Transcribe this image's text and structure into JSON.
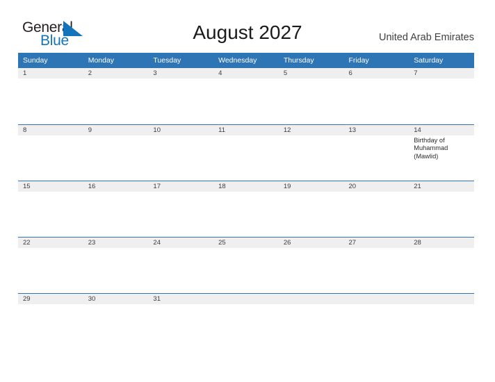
{
  "brand": {
    "name_part1": "General",
    "name_part2": "Blue",
    "triangle_color": "#1275bc",
    "text_color": "#231f20"
  },
  "header": {
    "title": "August 2027",
    "country": "United Arab Emirates"
  },
  "theme": {
    "header_blue": "#2e75b6",
    "day_band_gray": "#efefef",
    "page_background": "#ffffff",
    "row_border": "#2e75b6"
  },
  "calendar": {
    "month": "August",
    "year": "2027",
    "weekday_headers": [
      "Sunday",
      "Monday",
      "Tuesday",
      "Wednesday",
      "Thursday",
      "Friday",
      "Saturday"
    ],
    "weeks": [
      {
        "days": [
          {
            "date": "1",
            "event": ""
          },
          {
            "date": "2",
            "event": ""
          },
          {
            "date": "3",
            "event": ""
          },
          {
            "date": "4",
            "event": ""
          },
          {
            "date": "5",
            "event": ""
          },
          {
            "date": "6",
            "event": ""
          },
          {
            "date": "7",
            "event": ""
          }
        ]
      },
      {
        "days": [
          {
            "date": "8",
            "event": ""
          },
          {
            "date": "9",
            "event": ""
          },
          {
            "date": "10",
            "event": ""
          },
          {
            "date": "11",
            "event": ""
          },
          {
            "date": "12",
            "event": ""
          },
          {
            "date": "13",
            "event": ""
          },
          {
            "date": "14",
            "event": "Birthday of Muhammad (Mawlid)"
          }
        ]
      },
      {
        "days": [
          {
            "date": "15",
            "event": ""
          },
          {
            "date": "16",
            "event": ""
          },
          {
            "date": "17",
            "event": ""
          },
          {
            "date": "18",
            "event": ""
          },
          {
            "date": "19",
            "event": ""
          },
          {
            "date": "20",
            "event": ""
          },
          {
            "date": "21",
            "event": ""
          }
        ]
      },
      {
        "days": [
          {
            "date": "22",
            "event": ""
          },
          {
            "date": "23",
            "event": ""
          },
          {
            "date": "24",
            "event": ""
          },
          {
            "date": "25",
            "event": ""
          },
          {
            "date": "26",
            "event": ""
          },
          {
            "date": "27",
            "event": ""
          },
          {
            "date": "28",
            "event": ""
          }
        ]
      },
      {
        "days": [
          {
            "date": "29",
            "event": ""
          },
          {
            "date": "30",
            "event": ""
          },
          {
            "date": "31",
            "event": ""
          },
          {
            "date": "",
            "event": ""
          },
          {
            "date": "",
            "event": ""
          },
          {
            "date": "",
            "event": ""
          },
          {
            "date": "",
            "event": ""
          }
        ]
      }
    ]
  }
}
